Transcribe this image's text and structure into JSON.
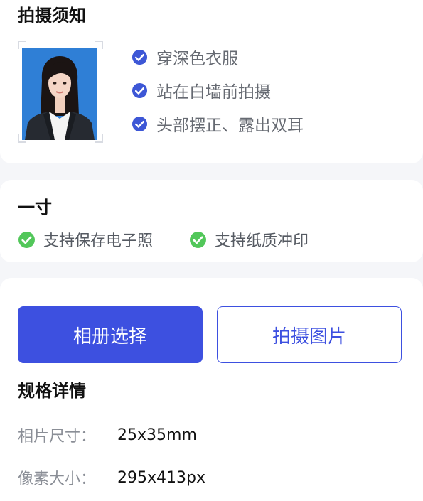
{
  "notes": {
    "title": "拍摄须知",
    "checklist": [
      {
        "text": "穿深色衣服",
        "icon": "check-circle-icon"
      },
      {
        "text": "站在白墙前拍摄",
        "icon": "check-circle-icon"
      },
      {
        "text": "头部摆正、露出双耳",
        "icon": "check-circle-icon"
      }
    ]
  },
  "size": {
    "title": "一寸",
    "features": [
      {
        "text": "支持保存电子照",
        "icon": "check-circle-icon"
      },
      {
        "text": "支持纸质冲印",
        "icon": "check-circle-icon"
      }
    ]
  },
  "actions": {
    "album_label": "相册选择",
    "camera_label": "拍摄图片"
  },
  "specs": {
    "title": "规格详情",
    "rows": [
      {
        "label": "相片尺寸：",
        "value": "25x35mm"
      },
      {
        "label": "像素大小：",
        "value": "295x413px"
      }
    ]
  },
  "colors": {
    "accent": "#3d50e0",
    "check_blue": "#3d57d6",
    "check_green": "#52c75a",
    "photo_background": "#2f7fd6",
    "page_background": "#f5f6f9"
  }
}
